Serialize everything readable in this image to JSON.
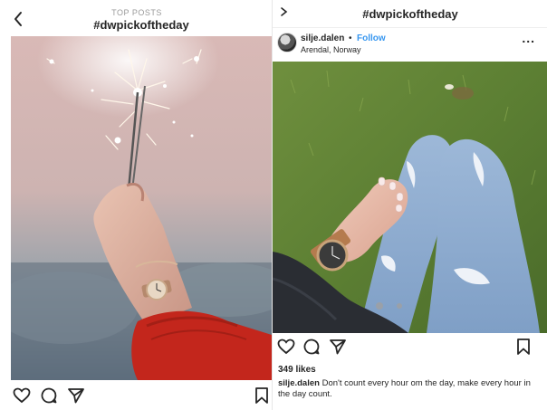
{
  "left_screen": {
    "header_subtitle": "TOP POSTS",
    "header_title": "#dwpickoftheday",
    "icons": [
      "back-arrow",
      "heart",
      "comment",
      "share",
      "bookmark"
    ]
  },
  "right_screen": {
    "header_title": "#dwpickoftheday",
    "post": {
      "username": "silje.dalen",
      "separator": "•",
      "follow_label": "Follow",
      "location": "Arendal, Norway",
      "more_label": "...",
      "likes": "349 likes",
      "caption_user": "silje.dalen",
      "caption_text": " Don't  count every hour om the day, make every hour in the day count."
    },
    "icons": [
      "chevron",
      "heart",
      "comment",
      "share",
      "bookmark",
      "more-dots"
    ]
  },
  "colors": {
    "accent_follow": "#3897f0",
    "text": "#262626",
    "muted": "#9a9a9a"
  }
}
